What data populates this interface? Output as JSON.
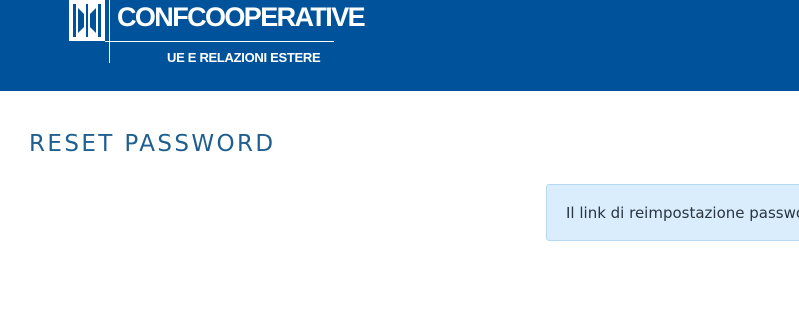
{
  "header": {
    "logo": {
      "brand": "CONFCOOPERATIVE",
      "subtitle": "UE E RELAZIONI ESTERE",
      "icon": "confcooperative-logo-icon"
    },
    "background_color": "#00539b"
  },
  "main": {
    "title": "RESET PASSWORD",
    "alert": {
      "message": "Il link di reimpostazione password",
      "background_color": "#d9edfd"
    }
  }
}
